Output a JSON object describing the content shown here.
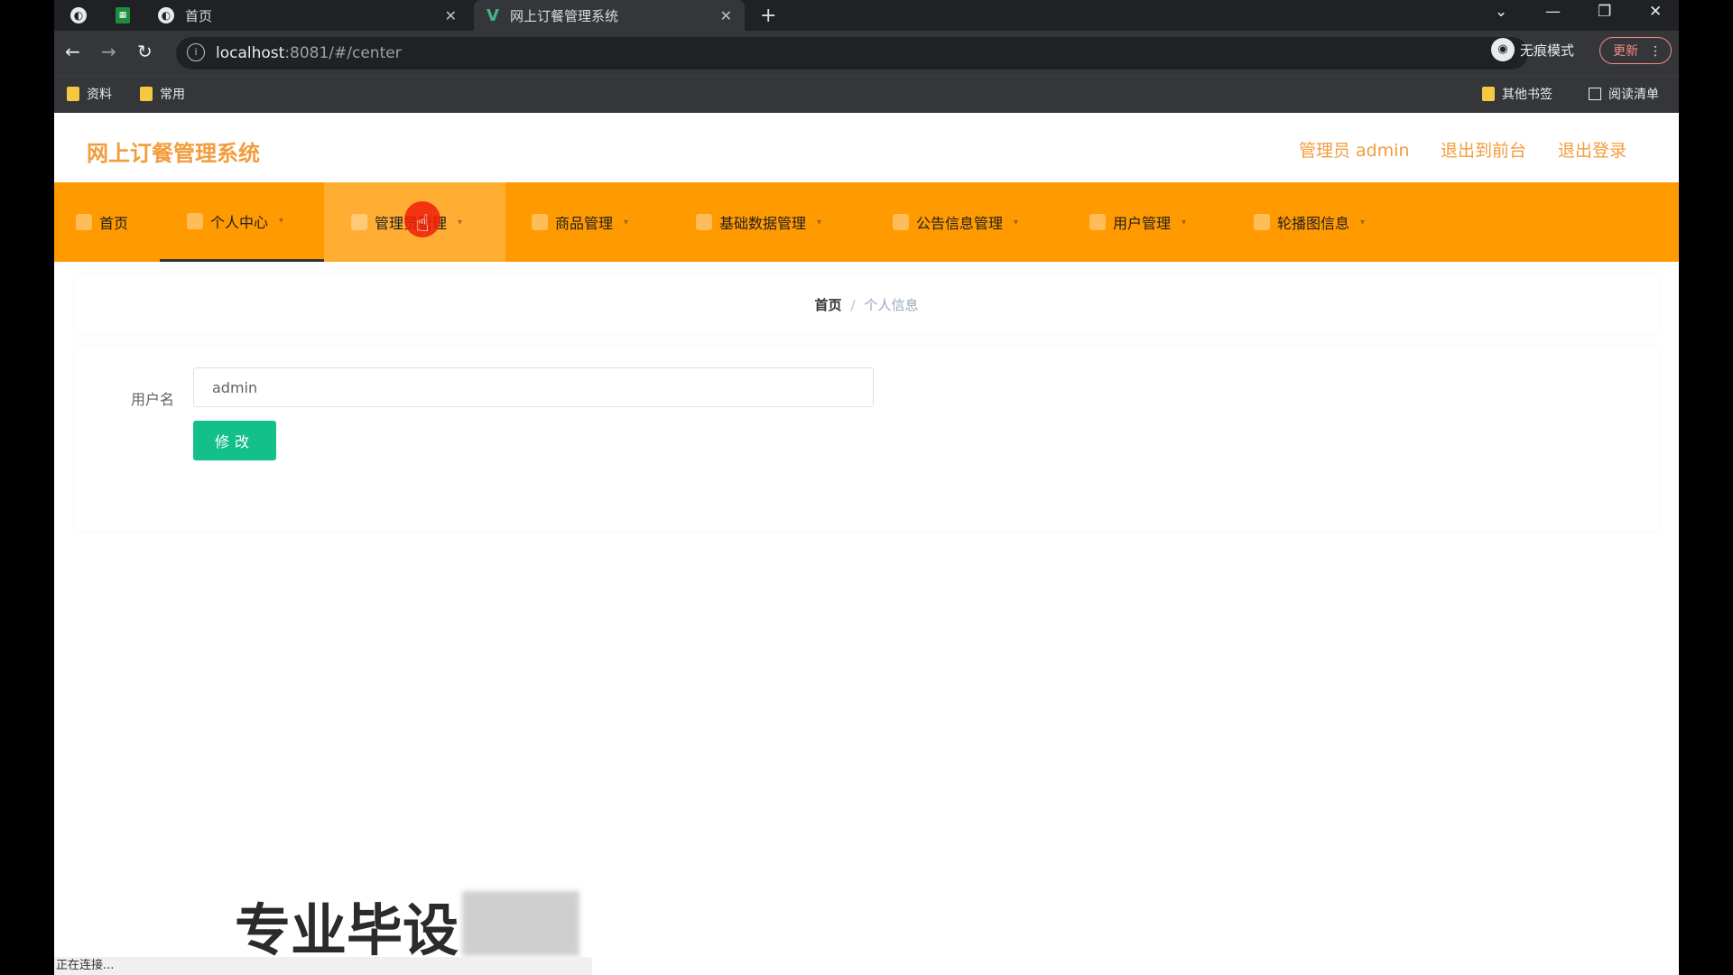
{
  "browser": {
    "tabs": [
      {
        "title": "首页"
      },
      {
        "title": "网上订餐管理系统"
      }
    ],
    "url_host": "localhost",
    "url_rest": ":8081/#/center",
    "incognito_label": "无痕模式",
    "update_label": "更新",
    "bookmarks": [
      "资料",
      "常用"
    ],
    "other_bookmarks": "其他书签",
    "reading_list": "阅读清单"
  },
  "site": {
    "title": "网上订餐管理系统",
    "admin_label": "管理员 admin",
    "exit_front": "退出到前台",
    "logout": "退出登录"
  },
  "menu": [
    {
      "label": "首页"
    },
    {
      "label": "个人中心"
    },
    {
      "label": "管理员管理"
    },
    {
      "label": "商品管理"
    },
    {
      "label": "基础数据管理"
    },
    {
      "label": "公告信息管理"
    },
    {
      "label": "用户管理"
    },
    {
      "label": "轮播图信息"
    }
  ],
  "breadcrumb": {
    "home": "首页",
    "sep": "/",
    "current": "个人信息"
  },
  "form": {
    "username_label": "用户名",
    "username_value": "admin",
    "submit_label": "修改"
  },
  "overlay": {
    "watermark": "专业毕设",
    "status": "正在连接..."
  }
}
